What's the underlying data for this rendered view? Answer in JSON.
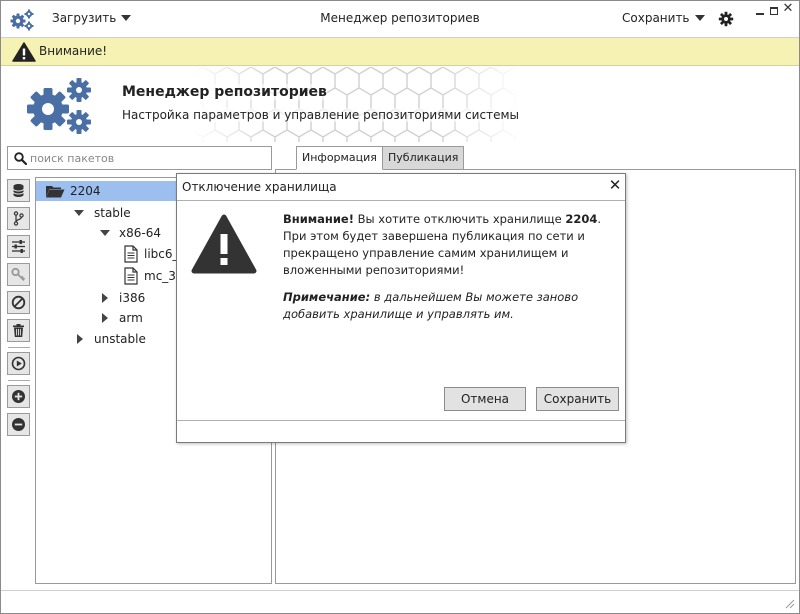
{
  "titlebar": {
    "menu_load": "Загрузить",
    "title": "Менеджер репозиториев",
    "menu_save": "Сохранить"
  },
  "warning": {
    "text": "Внимание!"
  },
  "header": {
    "title": "Менеджер репозиториев",
    "subtitle": "Настройка параметров и управление репозиториями системы"
  },
  "search": {
    "placeholder": "поиск пакетов"
  },
  "tabs": {
    "info": "Информация",
    "publication": "Публикация"
  },
  "tree": {
    "root": "2204",
    "stable": "stable",
    "x86_64": "x86-64",
    "file1": "libc6_",
    "file2": "mc_3",
    "i386": "i386",
    "arm": "arm",
    "unstable": "unstable"
  },
  "dialog": {
    "title": "Отключение хранилища",
    "warning_bold": "Внимание!",
    "message_before": " Вы хотите отключить хранилище ",
    "storage_name": "2204",
    "message_after": ". При этом будет завершена публикация по сети и прекращено управление самим хранилищем и вложенными репозиториями!",
    "note_bold": "Примечание:",
    "note_text": " в дальнейшем Вы можете заново добавить хранилище и управлять им.",
    "cancel_label": "Отмена",
    "save_label": "Сохранить"
  },
  "colors": {
    "icon_blue": "#4a6fa5",
    "warning_bg": "#f6f2b4",
    "selection": "#9cbff0",
    "toolbar_bg": "#e6e6e6"
  }
}
